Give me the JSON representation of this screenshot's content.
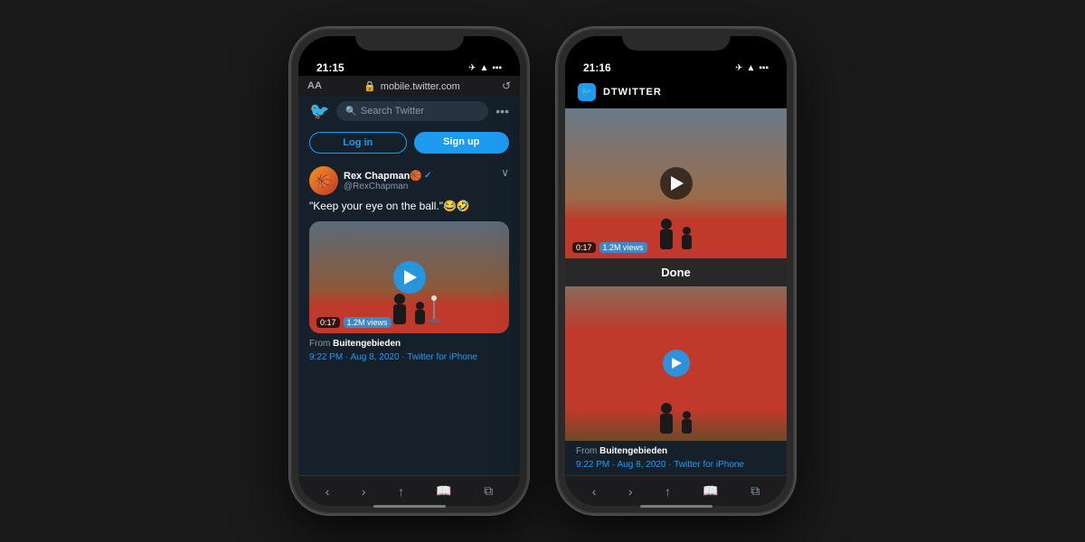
{
  "background": "#1a1a1a",
  "phones": [
    {
      "id": "left-phone",
      "status_bar": {
        "time": "21:15",
        "icons": "✈ ▲ ▪"
      },
      "browser": {
        "aa_label": "AA",
        "url": "mobile.twitter.com",
        "lock": "🔒",
        "refresh": "↺"
      },
      "header": {
        "twitter_logo": "🐦",
        "search_placeholder": "Search Twitter",
        "more": "•••"
      },
      "auth": {
        "login_label": "Log in",
        "signup_label": "Sign up"
      },
      "tweet": {
        "user_name": "Rex Chapman🏀",
        "verified": "✓",
        "handle": "@RexChapman",
        "text": "\"Keep your eye on the ball.\"😂🤣",
        "duration": "0:17",
        "views": "1.2M views",
        "source_prefix": "From ",
        "source_name": "Buitengebieden",
        "time": "9:22 PM · Aug 8, 2020 · Twitter for iPhone"
      },
      "nav": [
        "‹",
        "›",
        "↑",
        "📖",
        "⧉"
      ]
    },
    {
      "id": "right-phone",
      "status_bar": {
        "time": "21:16",
        "icons": "✈ ▲ ▪"
      },
      "app": {
        "icon": "🐦",
        "name": "DTWITTER"
      },
      "done_label": "Done",
      "tweet": {
        "duration": "0:17",
        "views": "1.2M views",
        "source_prefix": "From ",
        "source_name": "Buitengebieden",
        "time": "9:22 PM · Aug 8, 2020 · Twitter for iPhone"
      },
      "nav": [
        "‹",
        "›",
        "↑",
        "📖",
        "⧉"
      ]
    }
  ]
}
